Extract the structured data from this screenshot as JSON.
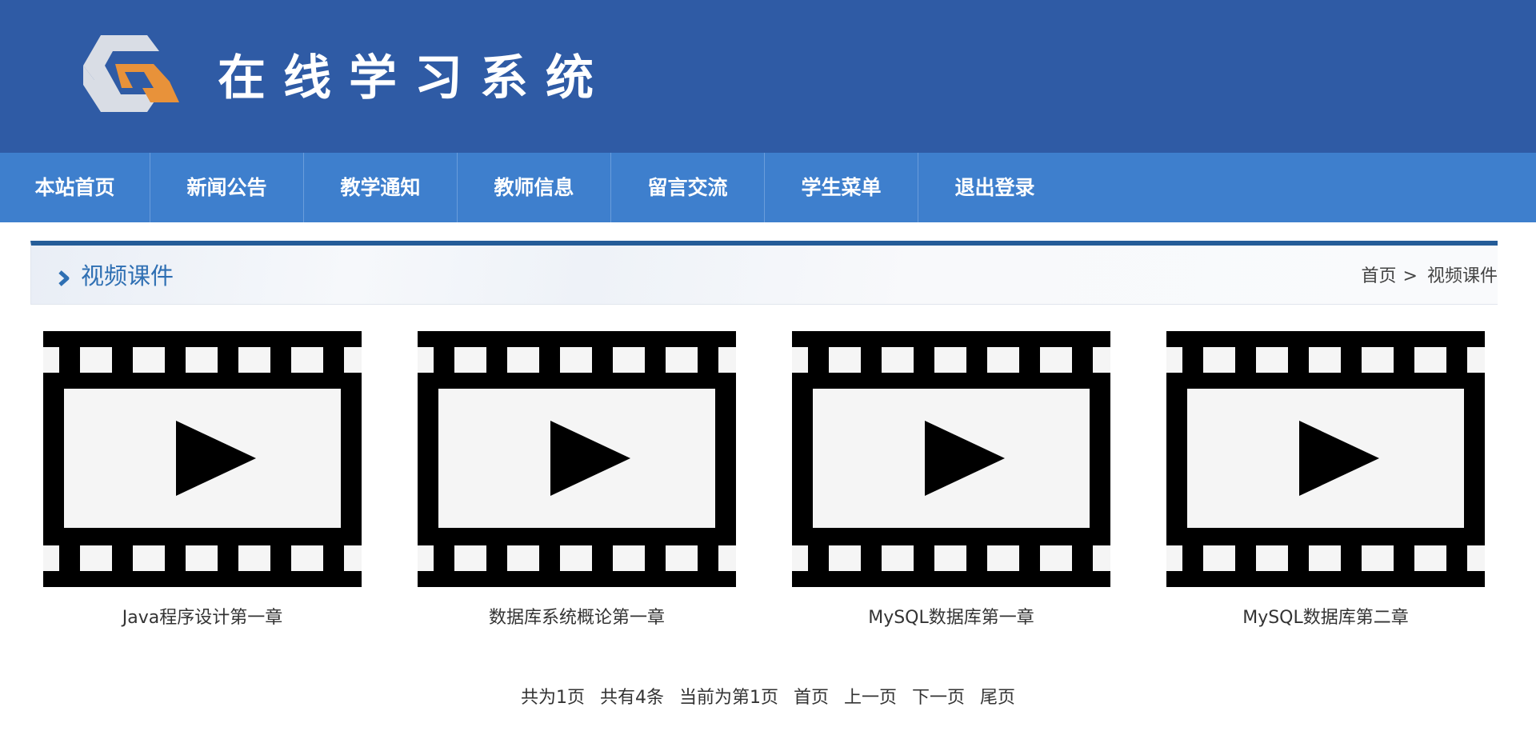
{
  "header": {
    "site_title": "在线学习系统"
  },
  "nav": {
    "items": [
      {
        "label": "本站首页"
      },
      {
        "label": "新闻公告"
      },
      {
        "label": "教学通知"
      },
      {
        "label": "教师信息"
      },
      {
        "label": "留言交流"
      },
      {
        "label": "学生菜单"
      },
      {
        "label": "退出登录"
      }
    ]
  },
  "section": {
    "title": "视频课件",
    "breadcrumb": {
      "home": "首页",
      "separator": ">",
      "current": "视频课件"
    }
  },
  "videos": [
    {
      "title": "Java程序设计第一章"
    },
    {
      "title": "数据库系统概论第一章"
    },
    {
      "title": "MySQL数据库第一章"
    },
    {
      "title": "MySQL数据库第二章"
    }
  ],
  "pagination": {
    "total_pages": "共为1页",
    "total_items": "共有4条",
    "current_page": "当前为第1页",
    "first": "首页",
    "prev": "上一页",
    "next": "下一页",
    "last": "尾页"
  },
  "colors": {
    "header_bg": "#2f5ba5",
    "nav_bg": "#3e7fcd",
    "section_border": "#245c98",
    "section_title": "#2e6fb3",
    "logo_orange": "#e8923a"
  },
  "icons": {
    "logo": "site-logo",
    "chevron": "chevron-right-icon",
    "thumbnail": "film-play-icon"
  }
}
